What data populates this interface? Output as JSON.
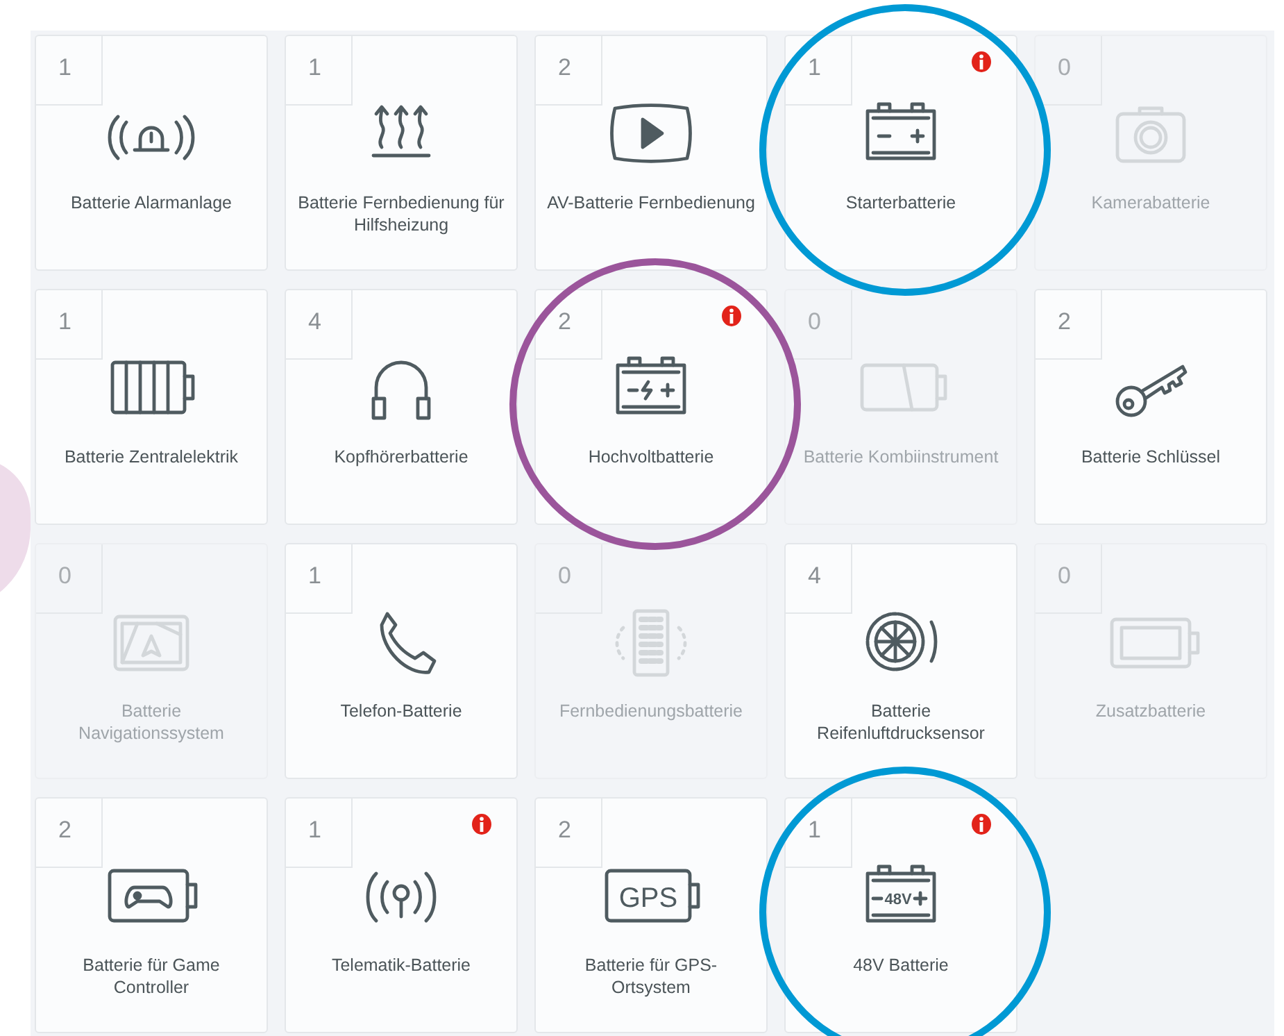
{
  "tiles": [
    {
      "count": "1",
      "label": "Batterie Alarmanlage",
      "kind": "alarm",
      "disabled": false,
      "alert": false
    },
    {
      "count": "1",
      "label": "Batterie Fernbedienung für Hilfsheizung",
      "kind": "heat",
      "disabled": false,
      "alert": false
    },
    {
      "count": "2",
      "label": "AV-Batterie Fernbedienung",
      "kind": "play",
      "disabled": false,
      "alert": false
    },
    {
      "count": "1",
      "label": "Starterbatterie",
      "kind": "starter",
      "disabled": false,
      "alert": true,
      "color": "#0099d4"
    },
    {
      "count": "0",
      "label": "Kamerabatterie",
      "kind": "camera",
      "disabled": true,
      "alert": false
    },
    {
      "count": "1",
      "label": "Batterie Zentralelektrik",
      "kind": "cells",
      "disabled": false,
      "alert": false
    },
    {
      "count": "4",
      "label": "Kopfhörerbatterie",
      "kind": "headphones",
      "disabled": false,
      "alert": false
    },
    {
      "count": "2",
      "label": "Hochvoltbatterie",
      "kind": "highvolt",
      "disabled": false,
      "alert": true,
      "color": "#9b559b"
    },
    {
      "count": "0",
      "label": "Batterie Kombiinstrument",
      "kind": "gauge",
      "disabled": true,
      "alert": false
    },
    {
      "count": "2",
      "label": "Batterie Schlüssel",
      "kind": "key",
      "disabled": false,
      "alert": false
    },
    {
      "count": "0",
      "label": "Batterie Navigationssystem",
      "kind": "navigation",
      "disabled": true,
      "alert": false
    },
    {
      "count": "1",
      "label": "Telefon-Batterie",
      "kind": "phone",
      "disabled": false,
      "alert": false
    },
    {
      "count": "0",
      "label": "Fernbedienungsbatterie",
      "kind": "remote",
      "disabled": true,
      "alert": false
    },
    {
      "count": "4",
      "label": "Batterie Reifenluftdrucksensor",
      "kind": "tire",
      "disabled": false,
      "alert": false
    },
    {
      "count": "0",
      "label": "Zusatzbatterie",
      "kind": "battery",
      "disabled": true,
      "alert": false
    },
    {
      "count": "2",
      "label": "Batterie für Game Controller",
      "kind": "gamepad",
      "disabled": false,
      "alert": false
    },
    {
      "count": "1",
      "label": "Telematik-Batterie",
      "kind": "antenna",
      "disabled": false,
      "alert": true
    },
    {
      "count": "2",
      "label": "Batterie für GPS-Ortsystem",
      "kind": "gps",
      "icon_text": "GPS",
      "disabled": false,
      "alert": false
    },
    {
      "count": "1",
      "label": "48V Batterie",
      "kind": "v48",
      "icon_text": "48V",
      "disabled": false,
      "alert": true,
      "color": "#0099d4"
    }
  ]
}
